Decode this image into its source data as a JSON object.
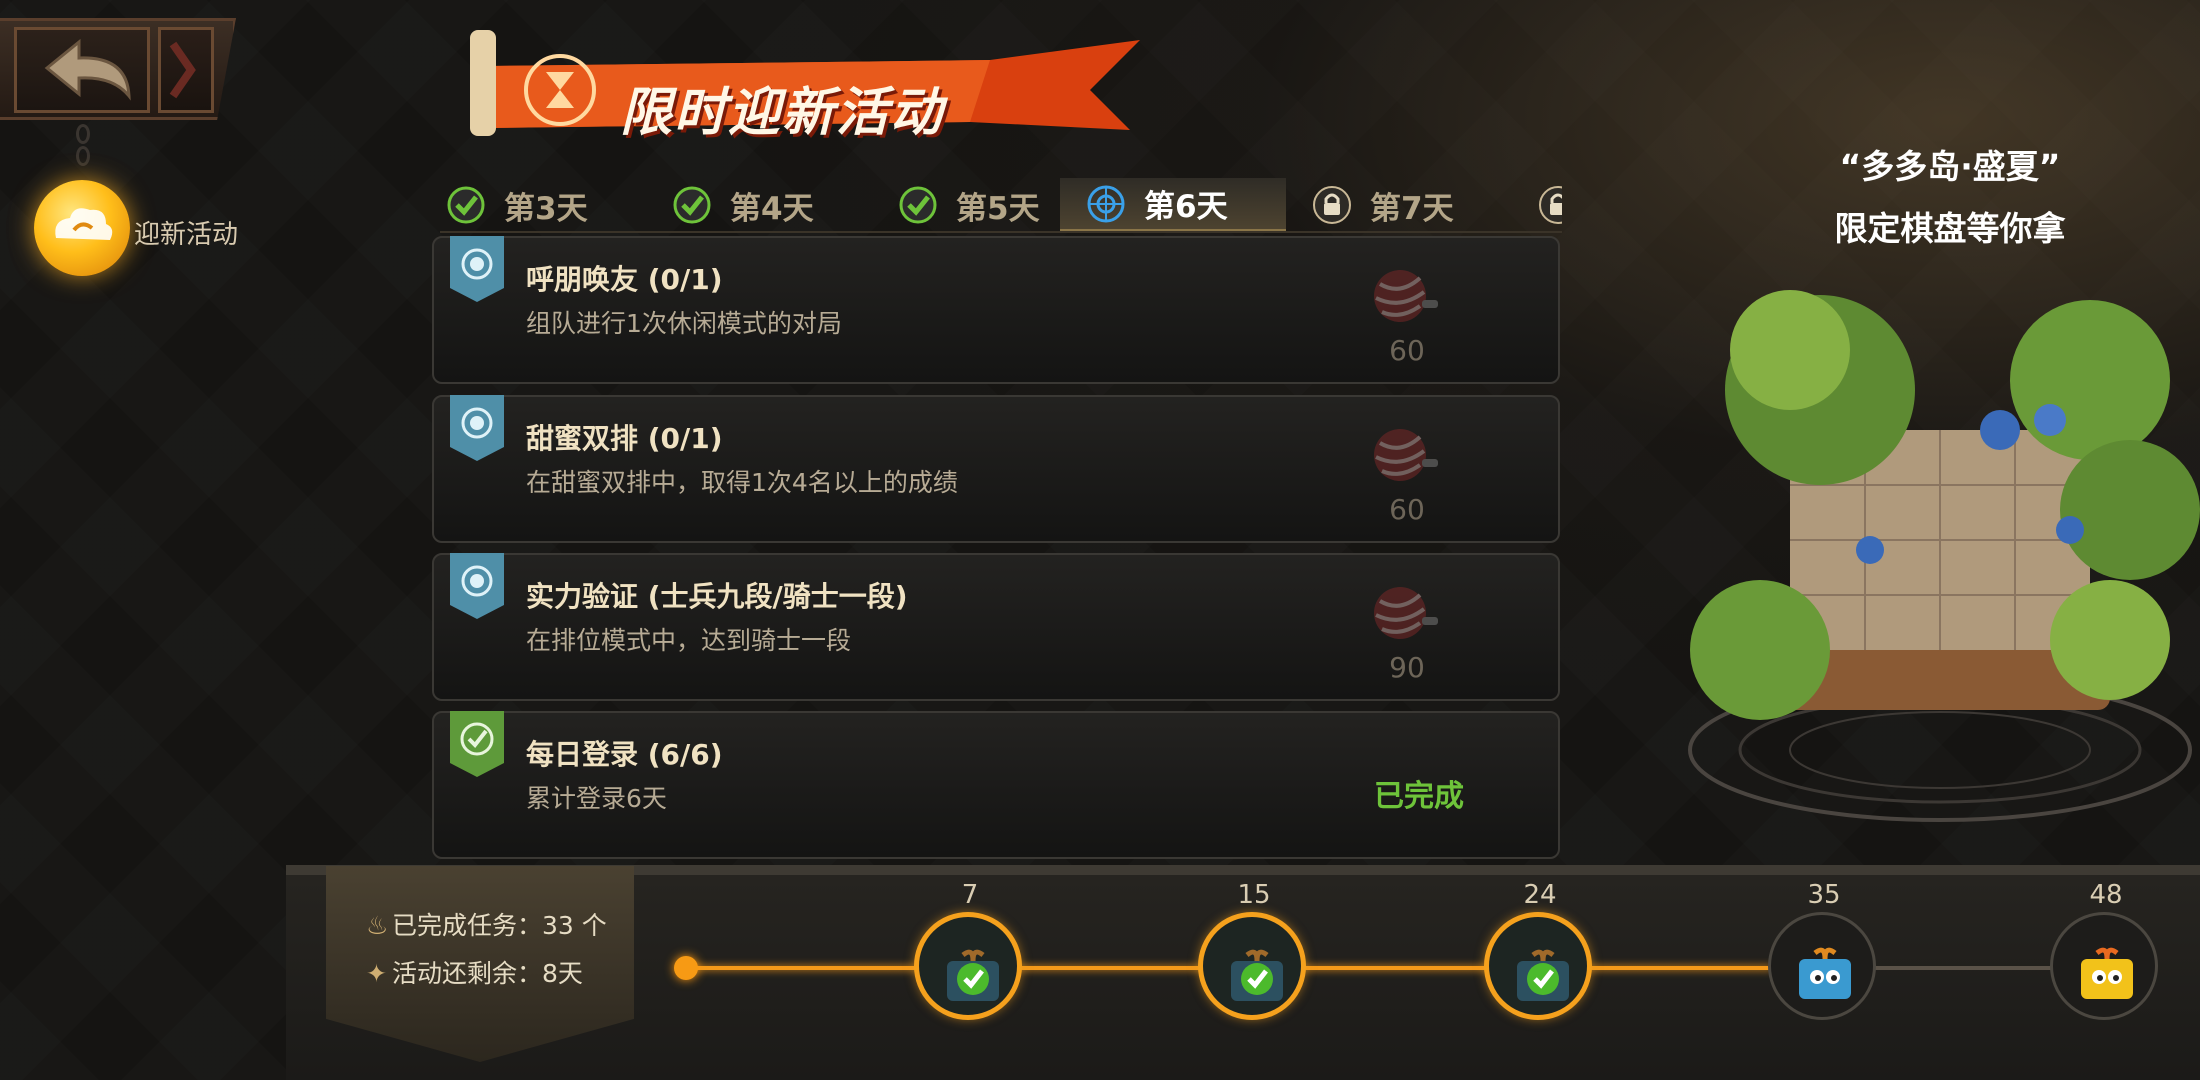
{
  "header": {
    "back_label": "",
    "title": "限时迎新活动"
  },
  "side_menu": {
    "items": [
      {
        "label": "迎新活动",
        "icon": "fire-cloud-icon",
        "selected": true
      }
    ]
  },
  "tabs": [
    {
      "label": "第3天",
      "state": "completed"
    },
    {
      "label": "第4天",
      "state": "completed"
    },
    {
      "label": "第5天",
      "state": "completed"
    },
    {
      "label": "第6天",
      "state": "active"
    },
    {
      "label": "第7天",
      "state": "locked"
    }
  ],
  "tasks": [
    {
      "title": "呼朋唤友 (0/1)",
      "desc": "组队进行1次休闲模式的对局",
      "reward": "60",
      "status": "pending"
    },
    {
      "title": "甜蜜双排 (0/1)",
      "desc": "在甜蜜双排中，取得1次4名以上的成绩",
      "reward": "60",
      "status": "pending"
    },
    {
      "title": "实力验证 (士兵九段/骑士一段)",
      "desc": "在排位模式中，达到骑士一段",
      "reward": "90",
      "status": "pending"
    },
    {
      "title": "每日登录 (6/6)",
      "desc": "累计登录6天",
      "done_label": "已完成",
      "status": "done"
    }
  ],
  "progress": {
    "completed_tasks": "已完成任务：33 个",
    "time_left": "活动还剩余：8天",
    "current": 33,
    "max": 48,
    "milestones": [
      {
        "value": "7",
        "claimed": true
      },
      {
        "value": "15",
        "claimed": true
      },
      {
        "value": "24",
        "claimed": true
      },
      {
        "value": "35",
        "claimed": false
      },
      {
        "value": "48",
        "claimed": false
      }
    ]
  },
  "promo": {
    "line1": "“多多岛·盛夏”",
    "line2": "限定棋盘等你拿"
  },
  "colors": {
    "accent_orange": "#f59a1a",
    "done_green": "#6ec33a",
    "banner_red": "#d9400f"
  }
}
